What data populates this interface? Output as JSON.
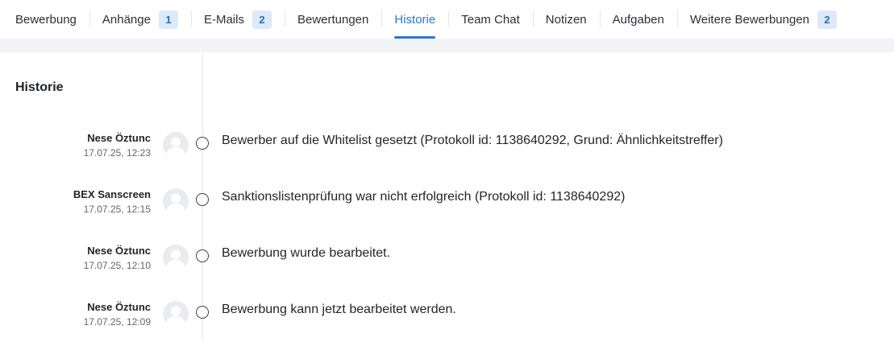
{
  "tabs": [
    {
      "label": "Bewerbung",
      "badge": null,
      "active": false
    },
    {
      "label": "Anhänge",
      "badge": "1",
      "active": false
    },
    {
      "label": "E-Mails",
      "badge": "2",
      "active": false
    },
    {
      "label": "Bewertungen",
      "badge": null,
      "active": false
    },
    {
      "label": "Historie",
      "badge": null,
      "active": true
    },
    {
      "label": "Team Chat",
      "badge": null,
      "active": false
    },
    {
      "label": "Notizen",
      "badge": null,
      "active": false
    },
    {
      "label": "Aufgaben",
      "badge": null,
      "active": false
    },
    {
      "label": "Weitere Bewerbungen",
      "badge": "2",
      "active": false
    }
  ],
  "section": {
    "title": "Historie"
  },
  "history": [
    {
      "author": "Nese Öztunc",
      "time": "17.07.25, 12:23",
      "message": "Bewerber auf die Whitelist gesetzt (Protokoll id: 1138640292, Grund: Ähnlichkeitstreffer)"
    },
    {
      "author": "BEX Sanscreen",
      "time": "17.07.25, 12:15",
      "message": "Sanktionslistenprüfung war nicht erfolgreich (Protokoll id: 1138640292)"
    },
    {
      "author": "Nese Öztunc",
      "time": "17.07.25, 12:10",
      "message": "Bewerbung wurde bearbeitet."
    },
    {
      "author": "Nese Öztunc",
      "time": "17.07.25, 12:09",
      "message": "Bewerbung kann jetzt bearbeitet werden."
    }
  ],
  "colors": {
    "accent": "#2a78d0",
    "badge_bg": "#dce9f8",
    "badge_text": "#2a6bb8"
  },
  "icons": {
    "avatar": "user-avatar-placeholder-icon",
    "timeline": "timeline-circle-icon"
  }
}
